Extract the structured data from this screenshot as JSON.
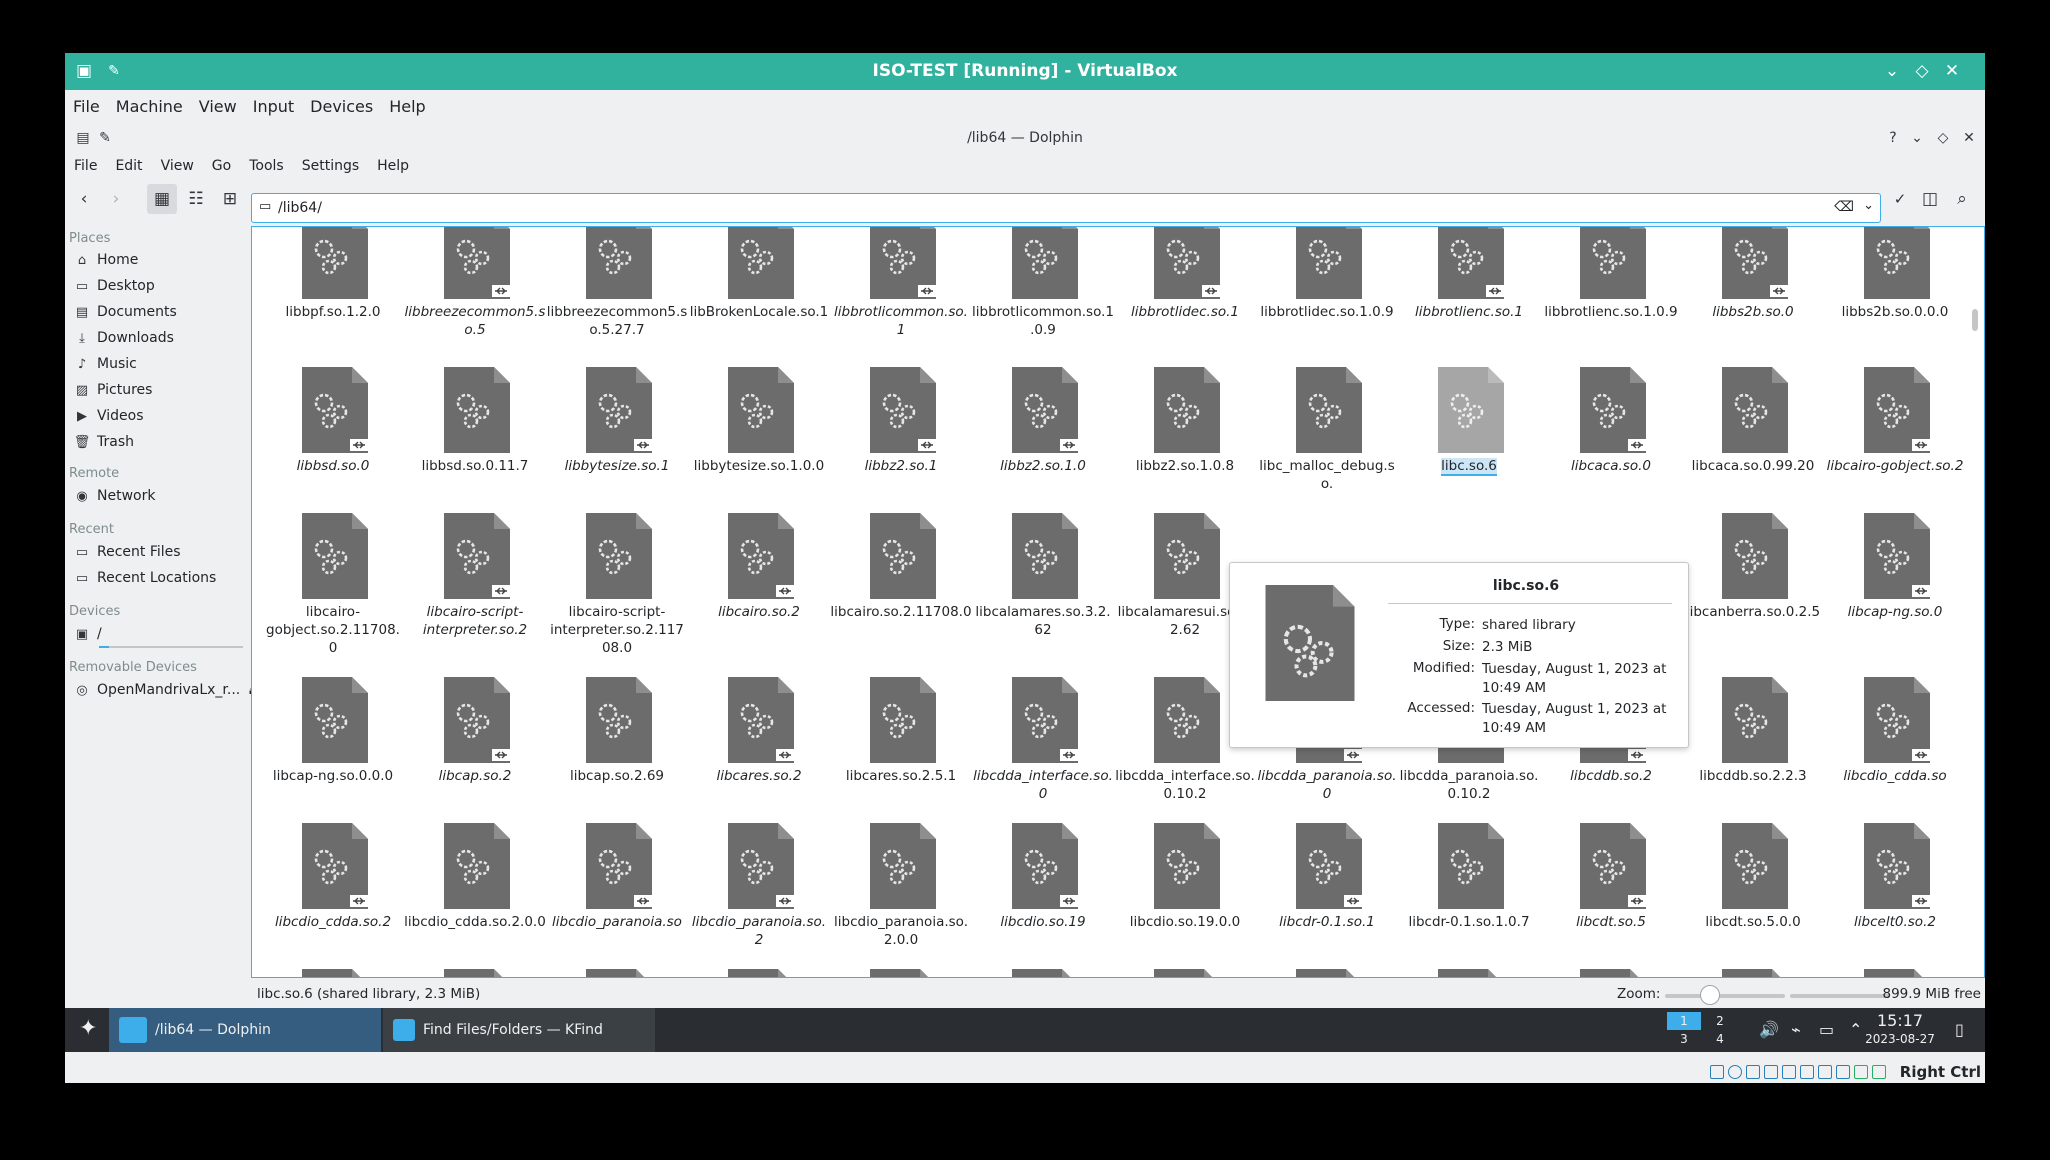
{
  "vbox": {
    "title": "ISO-TEST [Running] - VirtualBox",
    "menu": [
      "File",
      "Machine",
      "View",
      "Input",
      "Devices",
      "Help"
    ],
    "host_key": "Right Ctrl"
  },
  "dolphin": {
    "title": "/lib64 — Dolphin",
    "menu": [
      "File",
      "Edit",
      "View",
      "Go",
      "Tools",
      "Settings",
      "Help"
    ],
    "location": "/lib64/",
    "status_text": "libc.so.6 (shared library, 2.3 MiB)",
    "zoom_label": "Zoom:",
    "free_space": "899.9 MiB free"
  },
  "places": {
    "headers": {
      "places": "Places",
      "remote": "Remote",
      "recent": "Recent",
      "devices": "Devices",
      "removable": "Removable Devices"
    },
    "items": [
      {
        "label": "Home",
        "icon": "home-icon"
      },
      {
        "label": "Desktop",
        "icon": "desktop-icon"
      },
      {
        "label": "Documents",
        "icon": "documents-icon"
      },
      {
        "label": "Downloads",
        "icon": "downloads-icon"
      },
      {
        "label": "Music",
        "icon": "music-icon"
      },
      {
        "label": "Pictures",
        "icon": "pictures-icon"
      },
      {
        "label": "Videos",
        "icon": "videos-icon"
      },
      {
        "label": "Trash",
        "icon": "trash-icon"
      }
    ],
    "remote": [
      {
        "label": "Network",
        "icon": "network-icon"
      }
    ],
    "recent": [
      {
        "label": "Recent Files",
        "icon": "recent-files-icon"
      },
      {
        "label": "Recent Locations",
        "icon": "recent-locations-icon"
      }
    ],
    "devices": [
      {
        "label": "/",
        "icon": "drive-icon"
      }
    ],
    "removable": [
      {
        "label": "OpenMandrivaLx_r...",
        "icon": "optical-disc-icon"
      }
    ]
  },
  "files": [
    [
      {
        "name": "libbpf.so.1.2.0",
        "link": false
      },
      {
        "name": "libbreezecommon5.so.5",
        "link": true
      },
      {
        "name": "libbreezecommon5.so.5.27.7",
        "link": false
      },
      {
        "name": "libBrokenLocale.so.1",
        "link": false
      },
      {
        "name": "libbrotlicommon.so.1",
        "link": true
      },
      {
        "name": "libbrotlicommon.so.1.0.9",
        "link": false
      },
      {
        "name": "libbrotlidec.so.1",
        "link": true
      },
      {
        "name": "libbrotlidec.so.1.0.9",
        "link": false
      },
      {
        "name": "libbrotlienc.so.1",
        "link": true
      },
      {
        "name": "libbrotlienc.so.1.0.9",
        "link": false
      },
      {
        "name": "libbs2b.so.0",
        "link": true
      },
      {
        "name": "libbs2b.so.0.0.0",
        "link": false
      }
    ],
    [
      {
        "name": "libbsd.so.0",
        "link": true
      },
      {
        "name": "libbsd.so.0.11.7",
        "link": false
      },
      {
        "name": "libbytesize.so.1",
        "link": true
      },
      {
        "name": "libbytesize.so.1.0.0",
        "link": false
      },
      {
        "name": "libbz2.so.1",
        "link": true
      },
      {
        "name": "libbz2.so.1.0",
        "link": true
      },
      {
        "name": "libbz2.so.1.0.8",
        "link": false
      },
      {
        "name": "libc_malloc_debug.so.",
        "link": false
      },
      {
        "name": "libc.so.6",
        "link": false,
        "selected": true
      },
      {
        "name": "libcaca.so.0",
        "link": true
      },
      {
        "name": "libcaca.so.0.99.20",
        "link": false
      },
      {
        "name": "libcairo-gobject.so.2",
        "link": true
      }
    ],
    [
      {
        "name": "libcairo-gobject.so.2.11708.0",
        "link": false
      },
      {
        "name": "libcairo-script-interpreter.so.2",
        "link": true
      },
      {
        "name": "libcairo-script-interpreter.so.2.11708.0",
        "link": false
      },
      {
        "name": "libcairo.so.2",
        "link": true
      },
      {
        "name": "libcairo.so.2.11708.0",
        "link": false
      },
      {
        "name": "libcalamares.so.3.2.62",
        "link": false
      },
      {
        "name": "libcalamaresui.so.3.2.62",
        "link": false
      },
      {
        "name": "",
        "link": false,
        "hidden": true
      },
      {
        "name": "",
        "link": false,
        "hidden": true
      },
      {
        "name": "",
        "link": false,
        "hidden": true
      },
      {
        "name": "libcanberra.so.0.2.5",
        "link": false
      },
      {
        "name": "libcap-ng.so.0",
        "link": true
      }
    ],
    [
      {
        "name": "libcap-ng.so.0.0.0",
        "link": false
      },
      {
        "name": "libcap.so.2",
        "link": true
      },
      {
        "name": "libcap.so.2.69",
        "link": false
      },
      {
        "name": "libcares.so.2",
        "link": true
      },
      {
        "name": "libcares.so.2.5.1",
        "link": false
      },
      {
        "name": "libcdda_interface.so.0",
        "link": true
      },
      {
        "name": "libcdda_interface.so.0.10.2",
        "link": false
      },
      {
        "name": "libcdda_paranoia.so.0",
        "link": true
      },
      {
        "name": "libcdda_paranoia.so.0.10.2",
        "link": false
      },
      {
        "name": "libcddb.so.2",
        "link": true
      },
      {
        "name": "libcddb.so.2.2.3",
        "link": false
      },
      {
        "name": "libcdio_cdda.so",
        "link": true
      }
    ],
    [
      {
        "name": "libcdio_cdda.so.2",
        "link": true
      },
      {
        "name": "libcdio_cdda.so.2.0.0",
        "link": false
      },
      {
        "name": "libcdio_paranoia.so",
        "link": true
      },
      {
        "name": "libcdio_paranoia.so.2",
        "link": true
      },
      {
        "name": "libcdio_paranoia.so.2.0.0",
        "link": false
      },
      {
        "name": "libcdio.so.19",
        "link": true
      },
      {
        "name": "libcdio.so.19.0.0",
        "link": false
      },
      {
        "name": "libcdr-0.1.so.1",
        "link": true
      },
      {
        "name": "libcdr-0.1.so.1.0.7",
        "link": false
      },
      {
        "name": "libcdt.so.5",
        "link": true
      },
      {
        "name": "libcdt.so.5.0.0",
        "link": false
      },
      {
        "name": "libcelt0.so.2",
        "link": true
      }
    ]
  ],
  "tooltip": {
    "name": "libc.so.6",
    "type_label": "Type:",
    "type": "shared library",
    "size_label": "Size:",
    "size": "2.3 MiB",
    "modified_label": "Modified:",
    "modified": "Tuesday, August 1, 2023 at 10:49 AM",
    "accessed_label": "Accessed:",
    "accessed": "Tuesday, August 1, 2023 at 10:49 AM"
  },
  "taskbar": {
    "tasks": [
      {
        "label": "/lib64 — Dolphin",
        "active": true
      },
      {
        "label": "Find Files/Folders — KFind",
        "active": false
      }
    ],
    "pager": [
      "1",
      "2",
      "3",
      "4"
    ],
    "time": "15:17",
    "date": "2023-08-27"
  },
  "colors": {
    "titlebar": "#31b29e",
    "selection": "#3daee9",
    "taskbar": "#2a2e32",
    "icon_gray": "#6c6c6c"
  }
}
